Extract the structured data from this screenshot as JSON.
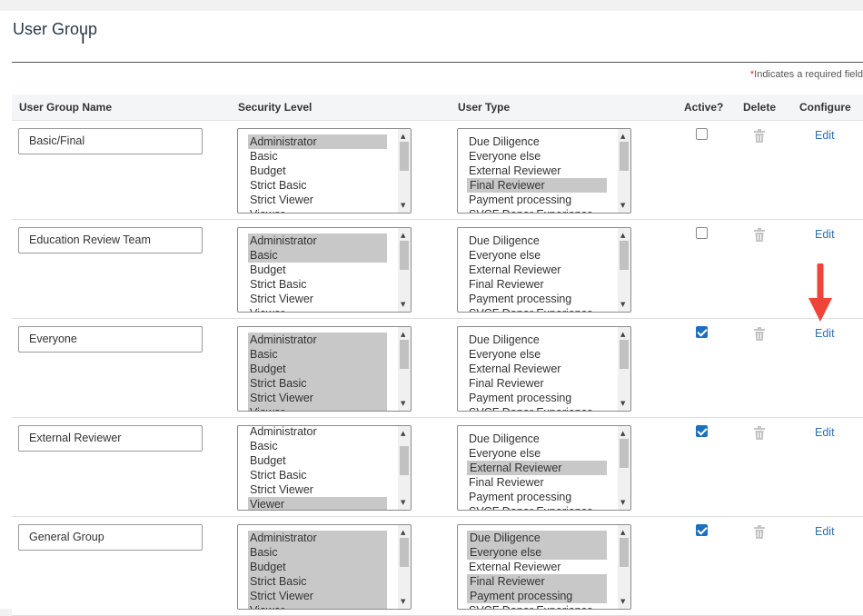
{
  "page": {
    "title": "User Group",
    "required_note": "Indicates a required field",
    "required_star": "*"
  },
  "columns": {
    "name": "User Group Name",
    "security": "Security Level",
    "user_type": "User Type",
    "active": "Active?",
    "delete": "Delete",
    "configure": "Configure"
  },
  "edit_label": "Edit",
  "rows": [
    {
      "name": "Basic/Final",
      "active": false,
      "security": [
        {
          "label": "Administrator",
          "selected": true
        },
        {
          "label": "Basic",
          "selected": false
        },
        {
          "label": "Budget",
          "selected": false
        },
        {
          "label": "Strict Basic",
          "selected": false
        },
        {
          "label": "Strict Viewer",
          "selected": false
        },
        {
          "label": "Viewer",
          "selected": false
        }
      ],
      "user_type": [
        {
          "label": "Due Diligence",
          "selected": false
        },
        {
          "label": "Everyone else",
          "selected": false
        },
        {
          "label": "External Reviewer",
          "selected": false
        },
        {
          "label": "Final Reviewer",
          "selected": true
        },
        {
          "label": "Payment processing",
          "selected": false
        },
        {
          "label": "SVCF Donor Experience",
          "selected": false
        }
      ]
    },
    {
      "name": "Education Review Team",
      "active": false,
      "security": [
        {
          "label": "Administrator",
          "selected": true
        },
        {
          "label": "Basic",
          "selected": true
        },
        {
          "label": "Budget",
          "selected": false
        },
        {
          "label": "Strict Basic",
          "selected": false
        },
        {
          "label": "Strict Viewer",
          "selected": false
        },
        {
          "label": "Viewer",
          "selected": false
        }
      ],
      "user_type": [
        {
          "label": "Due Diligence",
          "selected": false
        },
        {
          "label": "Everyone else",
          "selected": false
        },
        {
          "label": "External Reviewer",
          "selected": false
        },
        {
          "label": "Final Reviewer",
          "selected": false
        },
        {
          "label": "Payment processing",
          "selected": false
        },
        {
          "label": "SVCF Donor Experience",
          "selected": false
        }
      ]
    },
    {
      "name": "Everyone",
      "active": true,
      "security": [
        {
          "label": "Administrator",
          "selected": true
        },
        {
          "label": "Basic",
          "selected": true
        },
        {
          "label": "Budget",
          "selected": true
        },
        {
          "label": "Strict Basic",
          "selected": true
        },
        {
          "label": "Strict Viewer",
          "selected": true
        },
        {
          "label": "Viewer",
          "selected": true
        }
      ],
      "user_type": [
        {
          "label": "Due Diligence",
          "selected": false
        },
        {
          "label": "Everyone else",
          "selected": false
        },
        {
          "label": "External Reviewer",
          "selected": false
        },
        {
          "label": "Final Reviewer",
          "selected": false
        },
        {
          "label": "Payment processing",
          "selected": false
        },
        {
          "label": "SVCF Donor Experience",
          "selected": false
        }
      ]
    },
    {
      "name": "External Reviewer",
      "active": true,
      "security": [
        {
          "label": "Administrator",
          "selected": false
        },
        {
          "label": "Basic",
          "selected": false
        },
        {
          "label": "Budget",
          "selected": false
        },
        {
          "label": "Strict Basic",
          "selected": false
        },
        {
          "label": "Strict Viewer",
          "selected": false
        },
        {
          "label": "Viewer",
          "selected": true
        }
      ],
      "user_type": [
        {
          "label": "Due Diligence",
          "selected": false
        },
        {
          "label": "Everyone else",
          "selected": false
        },
        {
          "label": "External Reviewer",
          "selected": true
        },
        {
          "label": "Final Reviewer",
          "selected": false
        },
        {
          "label": "Payment processing",
          "selected": false
        },
        {
          "label": "SVCF Donor Experience",
          "selected": false
        }
      ]
    },
    {
      "name": "General Group",
      "active": true,
      "security": [
        {
          "label": "Administrator",
          "selected": true
        },
        {
          "label": "Basic",
          "selected": true
        },
        {
          "label": "Budget",
          "selected": true
        },
        {
          "label": "Strict Basic",
          "selected": true
        },
        {
          "label": "Strict Viewer",
          "selected": true
        },
        {
          "label": "Viewer",
          "selected": true
        }
      ],
      "user_type": [
        {
          "label": "Due Diligence",
          "selected": true
        },
        {
          "label": "Everyone else",
          "selected": true
        },
        {
          "label": "External Reviewer",
          "selected": false
        },
        {
          "label": "Final Reviewer",
          "selected": true
        },
        {
          "label": "Payment processing",
          "selected": true
        },
        {
          "label": "SVCF Donor Experience",
          "selected": false
        }
      ]
    }
  ]
}
